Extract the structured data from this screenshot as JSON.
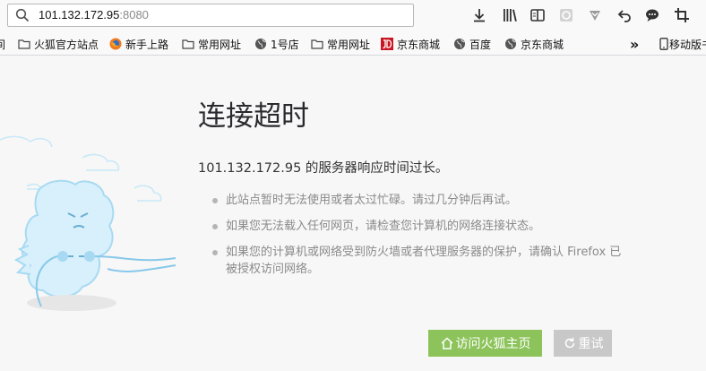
{
  "urlbar": {
    "host": "101.132.172.95",
    "port": ":8080"
  },
  "toolbar_icons": [
    "download-icon",
    "library-icon",
    "reader-view-icon",
    "extension-icon",
    "pocket-icon",
    "back-arrow-icon",
    "chat-icon",
    "crop-icon"
  ],
  "bookmarks": {
    "leading_partial": "间",
    "items": [
      {
        "label": "火狐官方站点",
        "icon": "folder-icon"
      },
      {
        "label": "新手上路",
        "icon": "firefox-icon"
      },
      {
        "label": "常用网址",
        "icon": "folder-icon"
      },
      {
        "label": "1号店",
        "icon": "globe-icon"
      },
      {
        "label": "常用网址",
        "icon": "folder-icon"
      },
      {
        "label": "京东商城",
        "icon": "jd-icon"
      },
      {
        "label": "百度",
        "icon": "globe-icon"
      },
      {
        "label": "京东商城",
        "icon": "globe-icon"
      }
    ],
    "overflow": "»",
    "mobile": "移动版书"
  },
  "error": {
    "title": "连接超时",
    "description": "101.132.172.95 的服务器响应时间过长。",
    "tips": [
      "此站点暂时无法使用或者太过忙碌。请过几分钟后再试。",
      "如果您无法载入任何网页，请检查您计算机的网络连接状态。",
      "如果您的计算机或网络受到防火墙或者代理服务器的保护，请确认 Firefox 已被授权访问网络。"
    ],
    "home_button": "访问火狐主页",
    "retry_button": "重试"
  },
  "colors": {
    "home_button": "#8cc35a",
    "retry_button": "#c8c8c8",
    "illustration": "#a7daf2"
  }
}
